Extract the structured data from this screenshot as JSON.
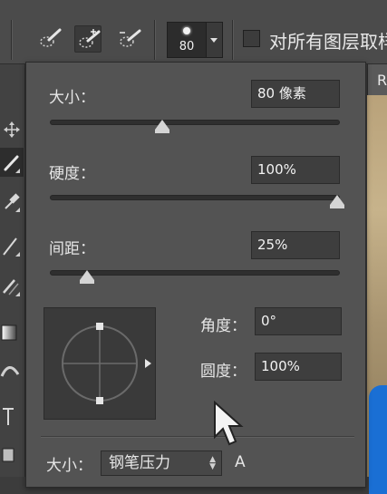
{
  "options_bar": {
    "brush_size_value": "80",
    "sample_all_layers_label": "对所有图层取样",
    "sample_all_layers_checked": false,
    "tool_modes": [
      "new-selection",
      "add-to-selection",
      "subtract-from-selection"
    ],
    "active_mode_index": 1
  },
  "document_tab": {
    "label": "R"
  },
  "brush_panel": {
    "size": {
      "label": "大小：",
      "value": "80 像素",
      "slider_fraction": 0.39
    },
    "hardness": {
      "label": "硬度：",
      "value": "100%",
      "slider_fraction": 1.0
    },
    "spacing": {
      "label": "间距：",
      "value": "25%",
      "slider_fraction": 0.125
    },
    "angle": {
      "label": "角度：",
      "value": "0°"
    },
    "roundness": {
      "label": "圆度：",
      "value": "100%"
    },
    "bottom": {
      "size_label": "大小：",
      "size_control_value": "钢笔压力",
      "extra_label": "A"
    }
  },
  "icons": {
    "tool_modes": [
      "quick-selection-icon",
      "add-quick-selection-icon",
      "subtract-quick-selection-icon"
    ],
    "toolbar": [
      "move-icon",
      "brush-icon",
      "eyedropper-icon",
      "pen-icon",
      "clone-icon",
      "gradient-icon",
      "smudge-icon",
      "type-icon",
      "rectangle-icon"
    ],
    "cursor": "arrow-cursor-icon"
  },
  "colors": {
    "panel_bg": "#535353",
    "field_bg": "#3e3e3e",
    "options_bar_bg": "#4b4b4b",
    "canvas_blue": "#1a6fd4"
  }
}
